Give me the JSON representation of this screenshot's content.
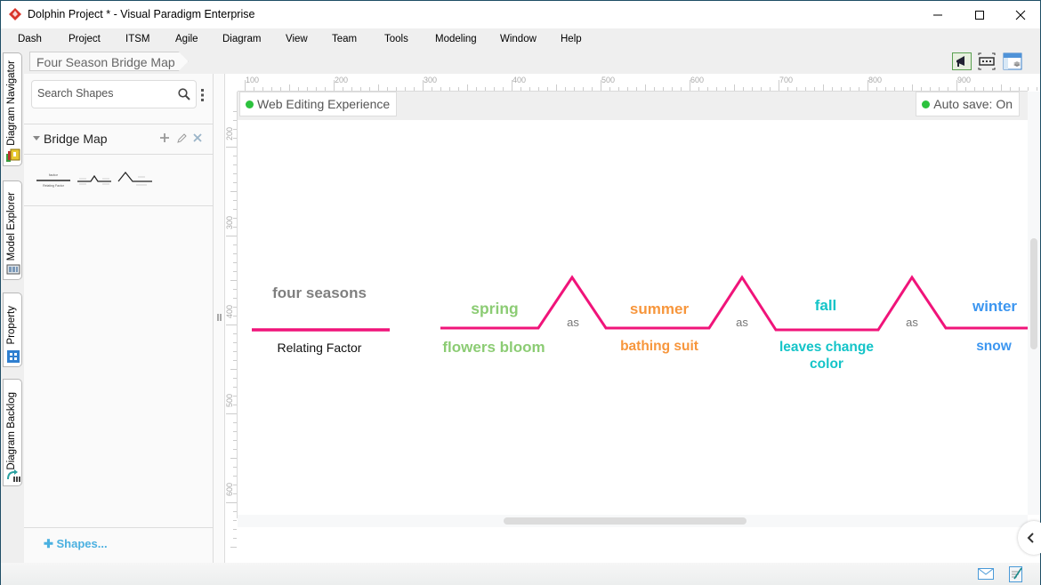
{
  "window": {
    "title": "Dolphin Project * - Visual Paradigm Enterprise",
    "controls": [
      "minimize",
      "maximize",
      "close"
    ]
  },
  "menu": [
    "Dash",
    "Project",
    "ITSM",
    "Agile",
    "Diagram",
    "View",
    "Team",
    "Tools",
    "Modeling",
    "Window",
    "Help"
  ],
  "side_tabs": [
    {
      "label": "Diagram Navigator",
      "icon": "diagram-navigator-icon"
    },
    {
      "label": "Model Explorer",
      "icon": "model-explorer-icon"
    },
    {
      "label": "Property",
      "icon": "property-icon"
    },
    {
      "label": "Diagram Backlog",
      "icon": "diagram-backlog-icon"
    }
  ],
  "breadcrumb": "Four Season Bridge Map",
  "toolbar_icons": [
    "megaphone-icon",
    "fit-diagram-icon",
    "layers-panel-icon"
  ],
  "palette": {
    "search_placeholder": "Search Shapes",
    "group_name": "Bridge Map",
    "thumbnails": [
      "relating-factor-shape",
      "bridge-shape",
      "analogy-shape"
    ],
    "thumb_texts": {
      "factor": "factor",
      "relating": "Relating Factor"
    },
    "shapes_link": "Shapes..."
  },
  "ruler": {
    "horizontal": [
      "100",
      "200",
      "300",
      "400",
      "500",
      "600",
      "700",
      "800",
      "900"
    ],
    "vertical": [
      "200",
      "300",
      "400",
      "500",
      "600"
    ]
  },
  "infobar": {
    "web_editing": "Web Editing Experience",
    "auto_save": "Auto save: On"
  },
  "diagram": {
    "relating_factor": {
      "top": "four seasons",
      "bottom": "Relating Factor"
    },
    "connector_word": "as",
    "line_color": "#f0147a",
    "pairs": [
      {
        "top": "spring",
        "bottom": "flowers bloom",
        "color": "#8ccc74"
      },
      {
        "top": "summer",
        "bottom": "bathing suit",
        "color": "#f7963c"
      },
      {
        "top": "fall",
        "bottom": "leaves change color",
        "color": "#14c4c8"
      },
      {
        "top": "winter",
        "bottom": "snow",
        "color": "#3c96f0"
      }
    ]
  },
  "statusbar_icons": [
    "mail-icon",
    "notes-icon"
  ]
}
